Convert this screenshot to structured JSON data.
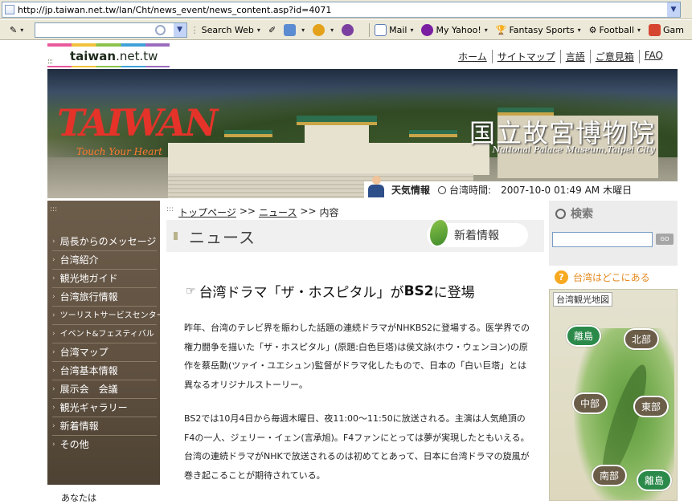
{
  "browser": {
    "url": "http://jp.taiwan.net.tw/lan/Cht/news_event/news_content.asp?id=4071",
    "toolbar": {
      "search_web": "Search Web",
      "mail": "Mail",
      "my_yahoo": "My Yahoo!",
      "fantasy_sports": "Fantasy Sports",
      "football": "Football",
      "games_cut": "Gam"
    }
  },
  "site": {
    "logo_dots": ":::",
    "logo_name": "taiwan",
    "logo_domain": ".net.tw",
    "topnav": [
      "ホーム",
      "サイトマップ",
      "言語",
      "ご意見箱",
      "FAQ"
    ]
  },
  "banner": {
    "taiwan_logo": "TAIWAN",
    "slogan": "Touch Your Heart",
    "museum_jp": "国立故宮博物院",
    "museum_en": "National Palace Museum,Taipei City",
    "weather_label": "天気情報",
    "time_label": "台湾時間:",
    "date": "2007-10-0",
    "time": "01:49 AM",
    "weekday": "木曜日"
  },
  "leftnav": {
    "dots": ":::",
    "items": [
      "局長からのメッセージ",
      "台湾紹介",
      "観光地ガイド",
      "台湾旅行情報",
      "ツーリストサービスセンター",
      "イベント&フェスティバル",
      "台湾マップ",
      "台湾基本情報",
      "展示会　会議",
      "観光ギャラリー",
      "新着情報",
      "その他"
    ]
  },
  "breadcrumb": {
    "dots": ":::",
    "home": "トップページ",
    "sep1": ">>",
    "news": "ニュース",
    "sep2": ">>",
    "current": "内容"
  },
  "news_header": {
    "title": "ニュース",
    "tab": "新着情報"
  },
  "article": {
    "title_pre": "台湾ドラマ「ザ・ホスピタル」が",
    "title_bold": "BS2",
    "title_post": "に登場",
    "paragraph1": "昨年、台湾のテレビ界を賑わした話題の連続ドラマがNHKBS2に登場する。医学界での権力闘争を描いた「ザ・ホスピタル」(原題:白色巨塔)は侯文詠(ホウ・ウェンヨン)の原作を蔡岳勳(ツァイ・ユエシュン)監督がドラマ化したもので、日本の「白い巨塔」とは異なるオリジナルストーリー。",
    "paragraph2": "BS2では10月4日から毎週木曜日、夜11:00～11:50に放送される。主演は人気絶頂のF4の一人、ジェリー・イェン(言承旭)。F4ファンにとっては夢が実現したともいえる。台湾の連続ドラマがNHKで放送されるのは初めてとあって、日本に台湾ドラマの旋風が巻き起こることが期待されている。"
  },
  "cutoff_text": "あなたは",
  "right": {
    "search_title": "検索",
    "search_value": "",
    "go": "GO",
    "where_label": "台湾はどこにある",
    "map_title": "台湾観光地図",
    "regions": {
      "islet_nw": "離島",
      "north": "北部",
      "central": "中部",
      "east": "東部",
      "south": "南部",
      "islet_se": "離島"
    }
  }
}
